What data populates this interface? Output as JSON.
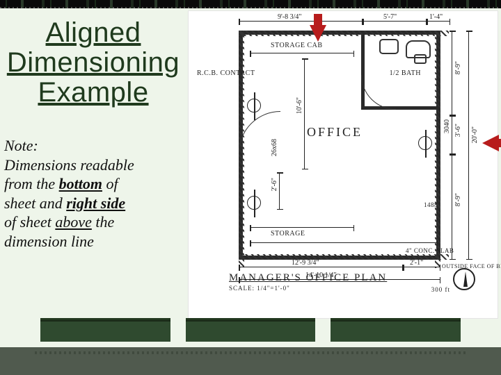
{
  "slide": {
    "title": "Aligned Dimensioning Example",
    "note_prefix": "Note:",
    "note_line1": "Dimensions readable",
    "note_line2a": "from the ",
    "note_bottom": "bottom",
    "note_line2b": " of",
    "note_line3a": "sheet and ",
    "note_rightside": "right side",
    "note_line4a": "of sheet ",
    "note_above": "above",
    "note_line4b": " the",
    "note_line5": "dimension line"
  },
  "plan": {
    "title": "MANAGER'S OFFICE PLAN",
    "scale": "SCALE: 1/4\"=1'-0\"",
    "room_label": "OFFICE",
    "bath_label": "1/2 BATH",
    "storage_label": "STORAGE CAB",
    "storage2_label": "STORAGE",
    "contact_label": "R.C.B. CONTACT",
    "slab_label": "4\" CONC. SLAB",
    "outside_label": "OUTSIDE FACE OF BLDG",
    "sheet_ref": "300 ft",
    "dims": {
      "top_left": "9'-8 3/4\"",
      "top_right": "5'-7\"",
      "top_end": "1'-4\"",
      "right_a": "8'-9\"",
      "right_b": "3'-6\"",
      "right_c": "8'-9\"",
      "right_total": "20'-0\"",
      "bottom_a": "12'-9 3/4\"",
      "bottom_b": "2'-1\"",
      "bottom_total": "14'-10 1/4\"",
      "left_mid": "10'-6\"",
      "left_low": "2'-6\"",
      "door_a": "26x68",
      "win_a": "3040",
      "win_b": "1488"
    }
  }
}
